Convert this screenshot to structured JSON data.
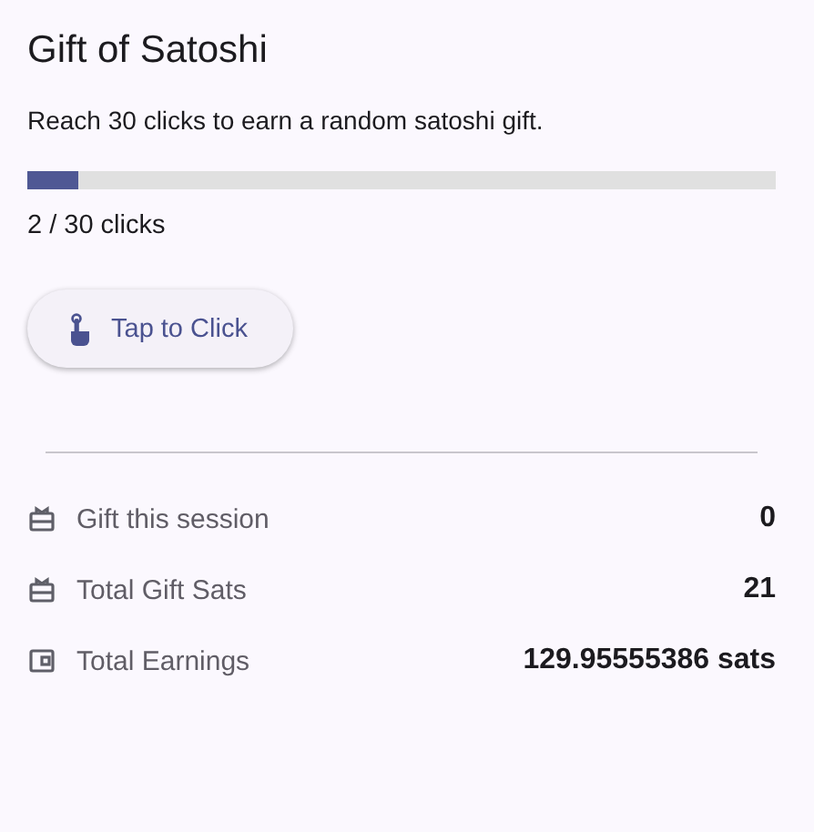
{
  "title": "Gift of Satoshi",
  "description": "Reach 30 clicks to earn a random satoshi gift.",
  "progress": {
    "level": 0.067,
    "reading": "2 / 30 clicks"
  },
  "tap_button": {
    "label": "Tap to Click"
  },
  "stats": [
    {
      "kind": "gift",
      "label": "Gift this session",
      "value": "0"
    },
    {
      "kind": "gift",
      "label": "Total Gift Sats",
      "value": "21"
    },
    {
      "kind": "wallet",
      "label": "Total Earnings",
      "value": "129.95555386 sats"
    }
  ]
}
